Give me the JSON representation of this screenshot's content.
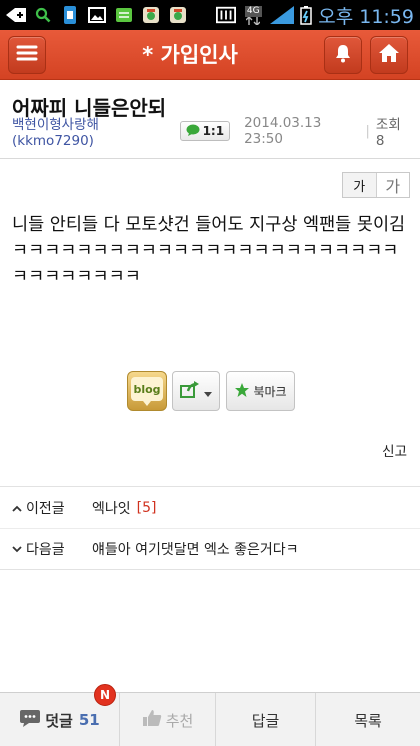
{
  "status": {
    "network": "4G",
    "time": "오후 11:59"
  },
  "header": {
    "title": "* 가입인사",
    "menu_icon": "menu-icon",
    "bell_icon": "bell-icon",
    "home_icon": "home-icon",
    "accent": "#d94a2b"
  },
  "post": {
    "title": "어짜피 니들은안되",
    "author": "백현이형사랑해(kkmo7290)",
    "chat_label": "1:1",
    "date": "2014.03.13 23:50",
    "views": "조회 8",
    "body": "니들 안티들 다 모토샷건 들어도 지구상 엑팬들 못이김ㅋㅋㅋㅋㅋㅋㅋㅋㅋㅋㅋㅋㅋㅋㅋㅋㅋㅋㅋㅋㅋㅋㅋㅋㅋㅋㅋㅋㅋㅋㅋㅋ"
  },
  "font_size": {
    "small": "가",
    "large": "가"
  },
  "actions": {
    "blog_label": "blog",
    "bookmark_label": "북마크",
    "report_label": "신고"
  },
  "navigation": {
    "prev": {
      "label": "이전글",
      "title": "엑나잇",
      "comments": "[5]"
    },
    "next": {
      "label": "다음글",
      "title": "얘들아 여기댓달면 엑소 좋은거다ㅋ"
    }
  },
  "bottom_bar": {
    "comments_label": "덧글",
    "comments_count": "51",
    "badge": "N",
    "recommend_label": "추천",
    "reply_label": "답글",
    "list_label": "목록"
  }
}
